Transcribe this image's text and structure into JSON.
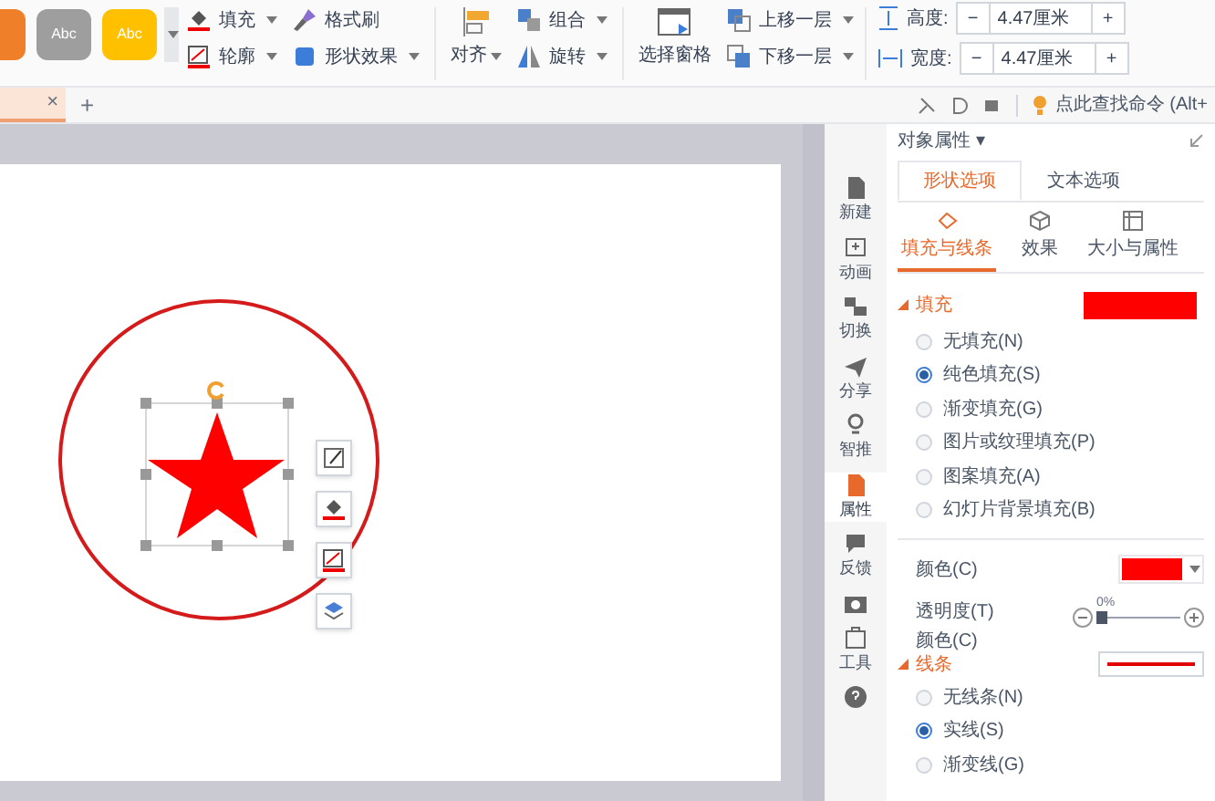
{
  "ribbon": {
    "style_swatches": [
      {
        "color": "#f07f2a"
      },
      {
        "label": "Abc",
        "color": "#9e9e9e"
      },
      {
        "label": "Abc",
        "color": "#ffc000"
      }
    ],
    "format_tools": [
      {
        "label": "填充",
        "dropdown": true
      },
      {
        "label": "格式刷",
        "dropdown": false
      },
      {
        "label": "轮廓",
        "dropdown": true
      },
      {
        "label": "形状效果",
        "dropdown": true
      }
    ],
    "align": {
      "label": "对齐"
    },
    "arrange_tools": [
      {
        "label": "组合"
      },
      {
        "label": "旋转"
      }
    ],
    "selection_pane": {
      "label": "选择窗格"
    },
    "layer_tools": [
      {
        "label": "上移一层"
      },
      {
        "label": "下移一层"
      }
    ],
    "size_fields": [
      {
        "label": "高度:",
        "value": "4.47厘米",
        "minus": "−",
        "plus": "+"
      },
      {
        "label": "宽度:",
        "value": "4.47厘米",
        "minus": "−",
        "plus": "+"
      }
    ]
  },
  "tabbar": {
    "close": "×",
    "add": "+",
    "search": "点此查找命令 (Alt+"
  },
  "side_rail": [
    {
      "label": "新建",
      "selected": false
    },
    {
      "label": "动画",
      "selected": false
    },
    {
      "label": "切换",
      "selected": false
    },
    {
      "label": "分享",
      "selected": false
    },
    {
      "label": "智推",
      "selected": false
    },
    {
      "label": "属性",
      "selected": true
    },
    {
      "label": "反馈",
      "selected": false
    },
    {
      "selected": false
    },
    {
      "label": "工具",
      "selected": false
    },
    {
      "selected": false
    }
  ],
  "panel": {
    "title": "对象属性 ▾",
    "tabs": [
      {
        "label": "形状选项",
        "selected": true
      },
      {
        "label": "文本选项",
        "selected": false
      }
    ],
    "subtabs": [
      {
        "label": "填充与线条",
        "selected": true
      },
      {
        "label": "效果",
        "selected": false
      },
      {
        "label": "大小与属性",
        "selected": false
      }
    ],
    "fill": {
      "heading": "填充",
      "color": "#ff0000",
      "options": [
        {
          "label": "无填充(N)",
          "selected": false
        },
        {
          "label": "纯色填充(S)",
          "selected": true
        },
        {
          "label": "渐变填充(G)",
          "selected": false
        },
        {
          "label": "图片或纹理填充(P)",
          "selected": false
        },
        {
          "label": "图案填充(A)",
          "selected": false
        },
        {
          "label": "幻灯片背景填充(B)",
          "selected": false
        }
      ],
      "color_label": "颜色(C)",
      "transparency_label": "透明度(T)",
      "transparency_reading": "0%",
      "level": 0.0
    },
    "line": {
      "color_label": "颜色(C)",
      "heading": "线条",
      "color": "#e00000",
      "options": [
        {
          "label": "无线条(N)",
          "selected": false
        },
        {
          "label": "实线(S)",
          "selected": true
        },
        {
          "label": "渐变线(G)",
          "selected": false
        }
      ]
    }
  }
}
